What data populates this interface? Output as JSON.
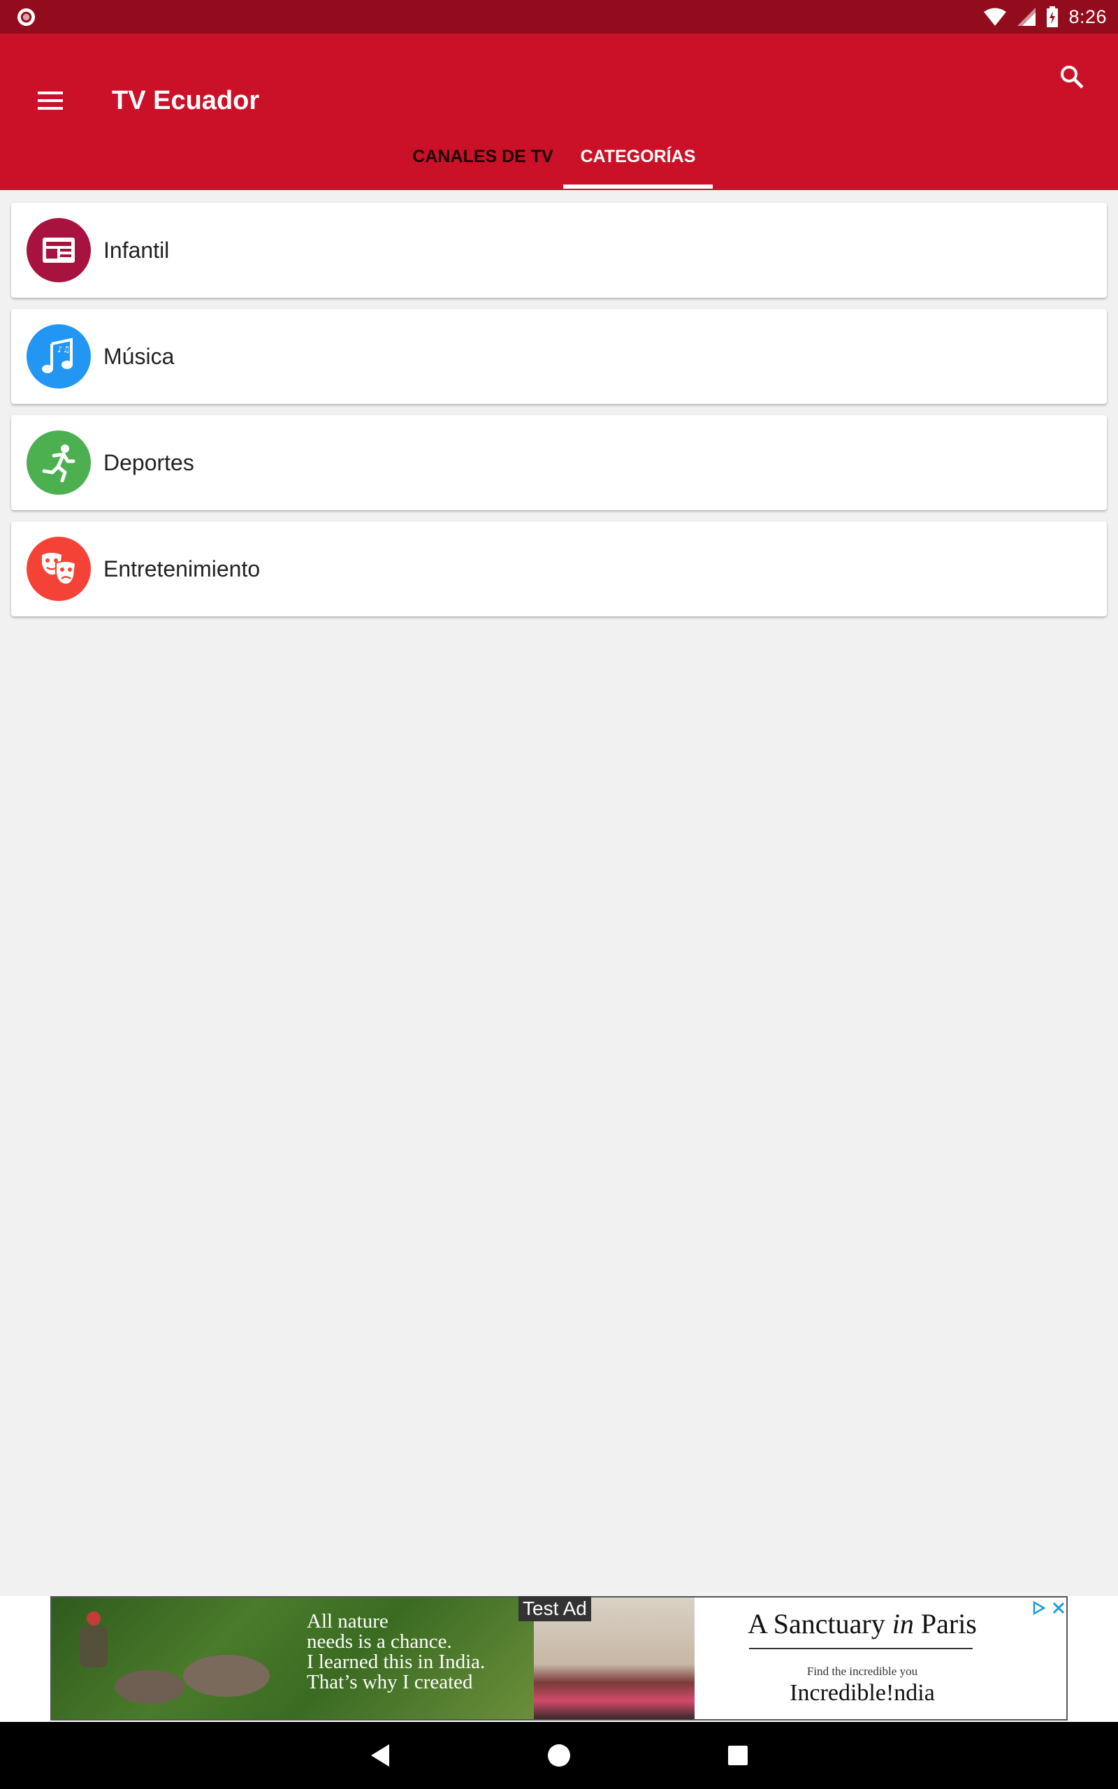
{
  "status_bar": {
    "time": "8:26",
    "left_icon": "notification-record-icon",
    "right_icons": [
      "wifi-icon",
      "cell-signal-icon",
      "battery-charging-icon"
    ]
  },
  "app_bar": {
    "title": "TV Ecuador",
    "menu_icon": "hamburger-menu-icon",
    "search_icon": "search-icon",
    "background_color": "#cb1127"
  },
  "tabs": [
    {
      "label": "CANALES DE TV",
      "selected": false
    },
    {
      "label": "CATEGORÍAS",
      "selected": true
    }
  ],
  "categories": [
    {
      "label": "Infantil",
      "icon": "newspaper-icon",
      "color": "#a8123f"
    },
    {
      "label": "Música",
      "icon": "music-note-icon",
      "color": "#2196f3"
    },
    {
      "label": "Deportes",
      "icon": "running-person-icon",
      "color": "#4caf50"
    },
    {
      "label": "Entretenimiento",
      "icon": "theater-masks-icon",
      "color": "#f44336"
    }
  ],
  "ad": {
    "label": "Test Ad",
    "text": "All nature\nneeds is a chance.\nI learned this in India.\nThat’s why I created",
    "headline_part1": "A Sanctuary ",
    "headline_in": "in",
    "headline_part2": " Paris",
    "sub": "Find the incredible you",
    "brand": "Incredible!ndia"
  },
  "nav_bar": {
    "back_icon": "back-triangle-icon",
    "home_icon": "home-circle-icon",
    "recents_icon": "recents-square-icon"
  }
}
